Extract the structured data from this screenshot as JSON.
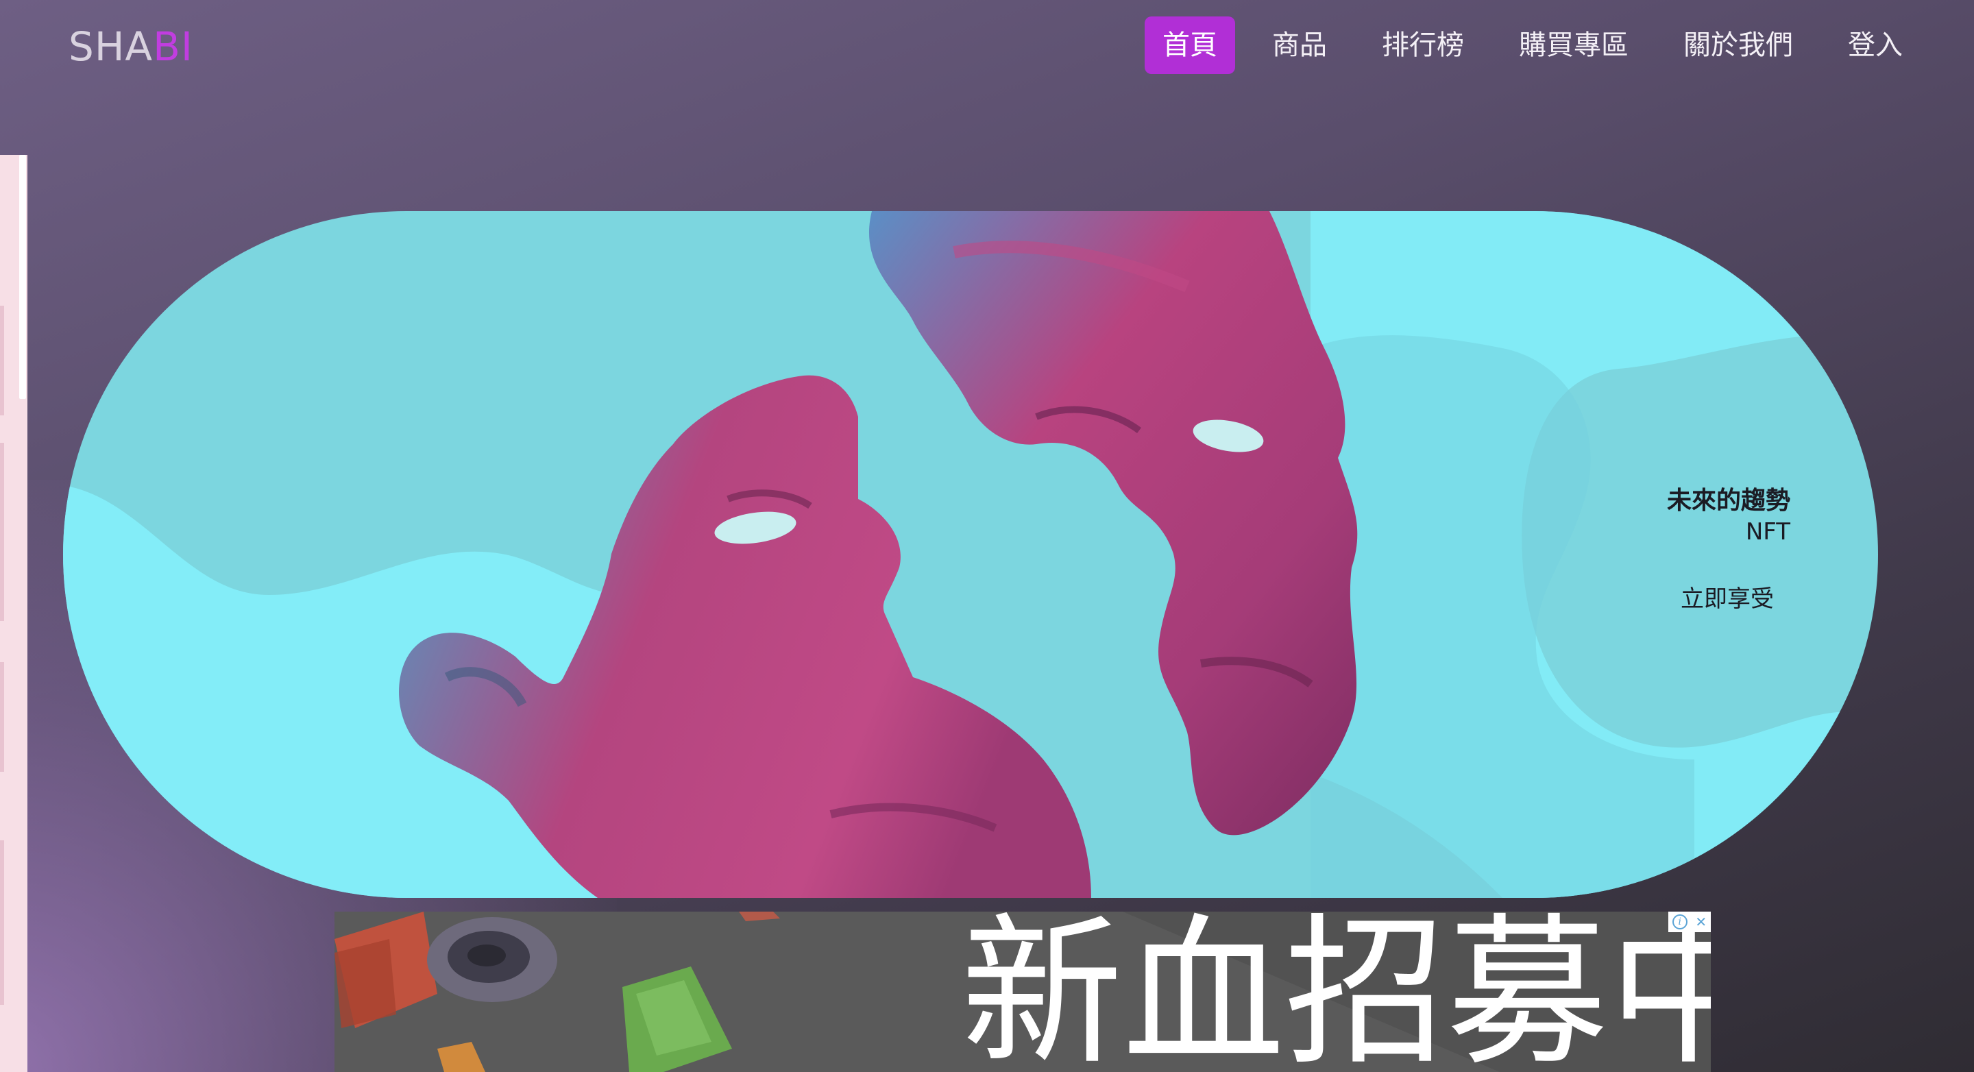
{
  "brand": {
    "part_a": "SHA",
    "part_b": "BI",
    "accent_color": "#c13de0"
  },
  "nav": {
    "items": [
      {
        "label": "首頁",
        "active": true
      },
      {
        "label": "商品",
        "active": false
      },
      {
        "label": "排行榜",
        "active": false
      },
      {
        "label": "購買專區",
        "active": false
      },
      {
        "label": "關於我們",
        "active": false
      },
      {
        "label": "登入",
        "active": false
      }
    ],
    "active_color": "#b12fd6"
  },
  "hero": {
    "title": "未來的趨勢",
    "subtitle": "NFT",
    "cta": "立即享受",
    "background_color": "#7cd6df",
    "image_subject": "two-split-faces-sculpture-artwork"
  },
  "ad": {
    "headline": "新血招募中",
    "info_icon": "info-icon",
    "close_icon": "close-icon"
  }
}
